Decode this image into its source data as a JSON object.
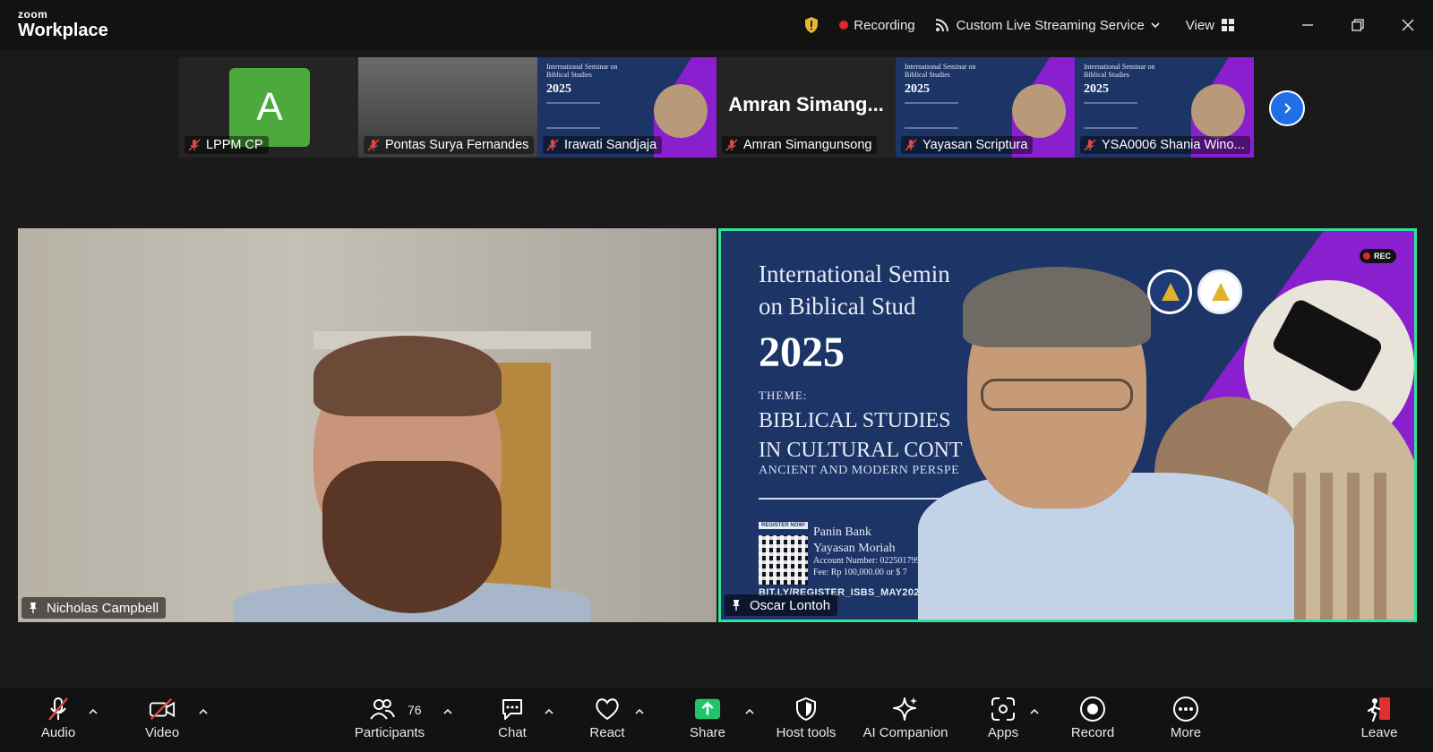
{
  "app": {
    "brand_top": "zoom",
    "brand_bottom": "Workplace"
  },
  "titlebar": {
    "recording_label": "Recording",
    "streaming_label": "Custom Live Streaming Service",
    "view_label": "View"
  },
  "thumbnails": [
    {
      "name": "LPPM CP",
      "avatar_letter": "A",
      "muted": true
    },
    {
      "name": "Pontas Surya Fernandes",
      "muted": true
    },
    {
      "name": "Irawati Sandjaja",
      "muted": true
    },
    {
      "name": "Amran Simangunsong",
      "tile_text": "Amran  Simang...",
      "muted": true
    },
    {
      "name": "Yayasan Scriptura",
      "muted": true
    },
    {
      "name": "YSA0006 Shania Wino...",
      "muted": true
    }
  ],
  "mini_poster": {
    "title": "International Seminar on Biblical Studies",
    "year": "2025",
    "sub": "BIBLICAL STUDIES IN CULTURAL CONTEXT"
  },
  "videos": {
    "left": {
      "name": "Nicholas Campbell",
      "pinned": true
    },
    "right": {
      "name": "Oscar Lontoh",
      "pinned": true,
      "active_speaker": true
    }
  },
  "poster": {
    "title_line1": "International Semin",
    "title_line2": "on Biblical Stud",
    "year": "2025",
    "theme_label": "THEME:",
    "subtitle_line1": "BIBLICAL STUDIES",
    "subtitle_line2": "IN CULTURAL CONT",
    "subtitle_line3": "ANCIENT AND MODERN PERSPE",
    "register_label": "REGISTER NOW!",
    "bank": "Panin Bank",
    "org": "Yayasan Moriah",
    "account": "Account Number: 0225017999",
    "fee": "Fee: Rp 100,000.00 or $ 7",
    "url": "BIT.LY/REGISTER_ISBS_MAY2025",
    "rec_badge": "REC"
  },
  "toolbar": {
    "audio": "Audio",
    "video": "Video",
    "participants": "Participants",
    "participants_count": "76",
    "chat": "Chat",
    "react": "React",
    "share": "Share",
    "host_tools": "Host tools",
    "ai_companion": "AI Companion",
    "apps": "Apps",
    "record": "Record",
    "more": "More",
    "leave": "Leave"
  },
  "colors": {
    "active_border": "#2fe49a",
    "share_green": "#21c46a",
    "record_red": "#e02828",
    "accent_blue": "#1f6fe6"
  },
  "icons": [
    "shield-icon",
    "record-dot-icon",
    "stream-icon",
    "chevron-down-icon",
    "grid-icon",
    "minimize-icon",
    "restore-icon",
    "close-icon",
    "mic-muted-icon",
    "pin-icon",
    "next-arrow-icon",
    "video-off-icon",
    "participants-icon",
    "chat-icon",
    "heart-icon",
    "share-arrow-icon",
    "host-shield-icon",
    "ai-sparkle-icon",
    "apps-icon",
    "record-icon",
    "more-icon",
    "leave-icon"
  ]
}
